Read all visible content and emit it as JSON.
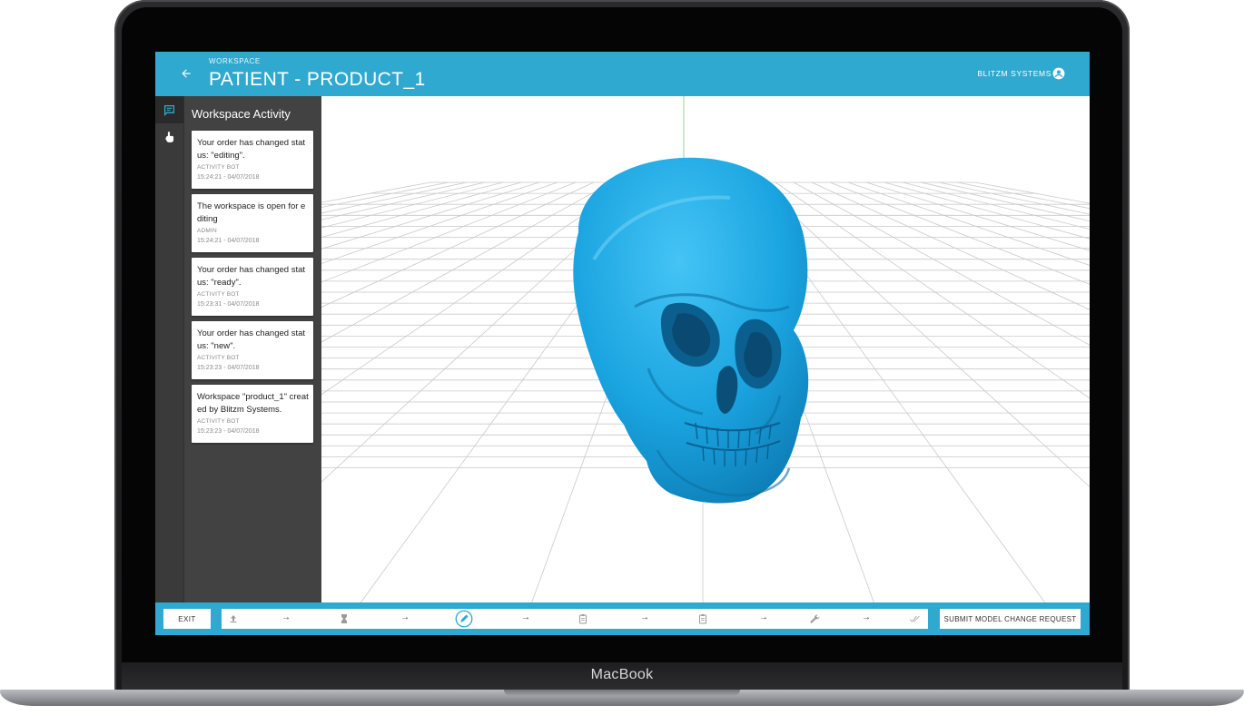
{
  "device": {
    "label": "MacBook"
  },
  "header": {
    "kicker": "WORKSPACE",
    "title": "PATIENT - PRODUCT_1",
    "company": "BLITZM SYSTEMS",
    "back_icon": "arrow-back-icon",
    "account_icon": "account-circle-icon"
  },
  "sidebar": {
    "rail": [
      {
        "icon": "chat-icon",
        "active": true
      },
      {
        "icon": "touch-icon",
        "active": false
      }
    ],
    "title": "Workspace Activity",
    "activities": [
      {
        "message": "Your order has changed status: \"editing\".",
        "author": "ACTIVITY BOT",
        "time": "15:24:21 - 04/07/2018"
      },
      {
        "message": "The workspace is open for editing",
        "author": "ADMIN",
        "time": "15:24:21 - 04/07/2018"
      },
      {
        "message": "Your order has changed status: \"ready\".",
        "author": "ACTIVITY BOT",
        "time": "15:23:31 - 04/07/2018"
      },
      {
        "message": "Your order has changed status: \"new\".",
        "author": "ACTIVITY BOT",
        "time": "15:23:23 - 04/07/2018"
      },
      {
        "message": "Workspace \"product_1\" created by Blitzm Systems.",
        "author": "ACTIVITY BOT",
        "time": "15:23:23 - 04/07/2018"
      }
    ]
  },
  "toolbar": {
    "exit_label": "EXIT",
    "submit_label": "SUBMIT MODEL CHANGE REQUEST",
    "arrow": "→",
    "steps": [
      {
        "icon": "upload-icon",
        "state": "done"
      },
      {
        "icon": "hourglass-icon",
        "state": "done"
      },
      {
        "icon": "edit-icon",
        "state": "current"
      },
      {
        "icon": "clipboard-icon",
        "state": "pending"
      },
      {
        "icon": "clipboard-icon",
        "state": "pending"
      },
      {
        "icon": "wrench-icon",
        "state": "pending"
      },
      {
        "icon": "double-check-icon",
        "state": "pending"
      }
    ]
  },
  "colors": {
    "accent": "#2fa9cf",
    "model": "#1aa4e0",
    "sidebar": "#424242",
    "rail": "#3a3a3a"
  }
}
